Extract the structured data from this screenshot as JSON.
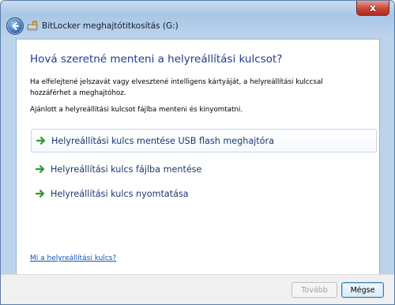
{
  "window": {
    "title": "BitLocker meghajtótitkosítás (G:)",
    "close_glyph": "x"
  },
  "content": {
    "heading": "Hová szeretné menteni a helyreállítási kulcsot?",
    "description": "Ha elfelejtené jelszavát vagy elvesztené intelligens kártyáját, a helyreállítási kulccsal hozzáférhet a meghajtóhoz.",
    "recommendation": "Ajánlott a helyreállítási kulcsot fájlba menteni és kinyomtatni.",
    "options": [
      {
        "label": "Helyreállítási kulcs mentése USB flash meghajtóra",
        "icon": "green-arrow-icon"
      },
      {
        "label": "Helyreállítási kulcs fájlba mentése",
        "icon": "green-arrow-icon"
      },
      {
        "label": "Helyreállítási kulcs nyomtatása",
        "icon": "green-arrow-icon"
      }
    ],
    "help_link": "Mi a helyreállítási kulcs?"
  },
  "footer": {
    "next_label": "Tovább",
    "cancel_label": "Mégse"
  },
  "colors": {
    "heading": "#1e3d8f",
    "link": "#0f57b0",
    "arrow": "#2e9a2e"
  }
}
